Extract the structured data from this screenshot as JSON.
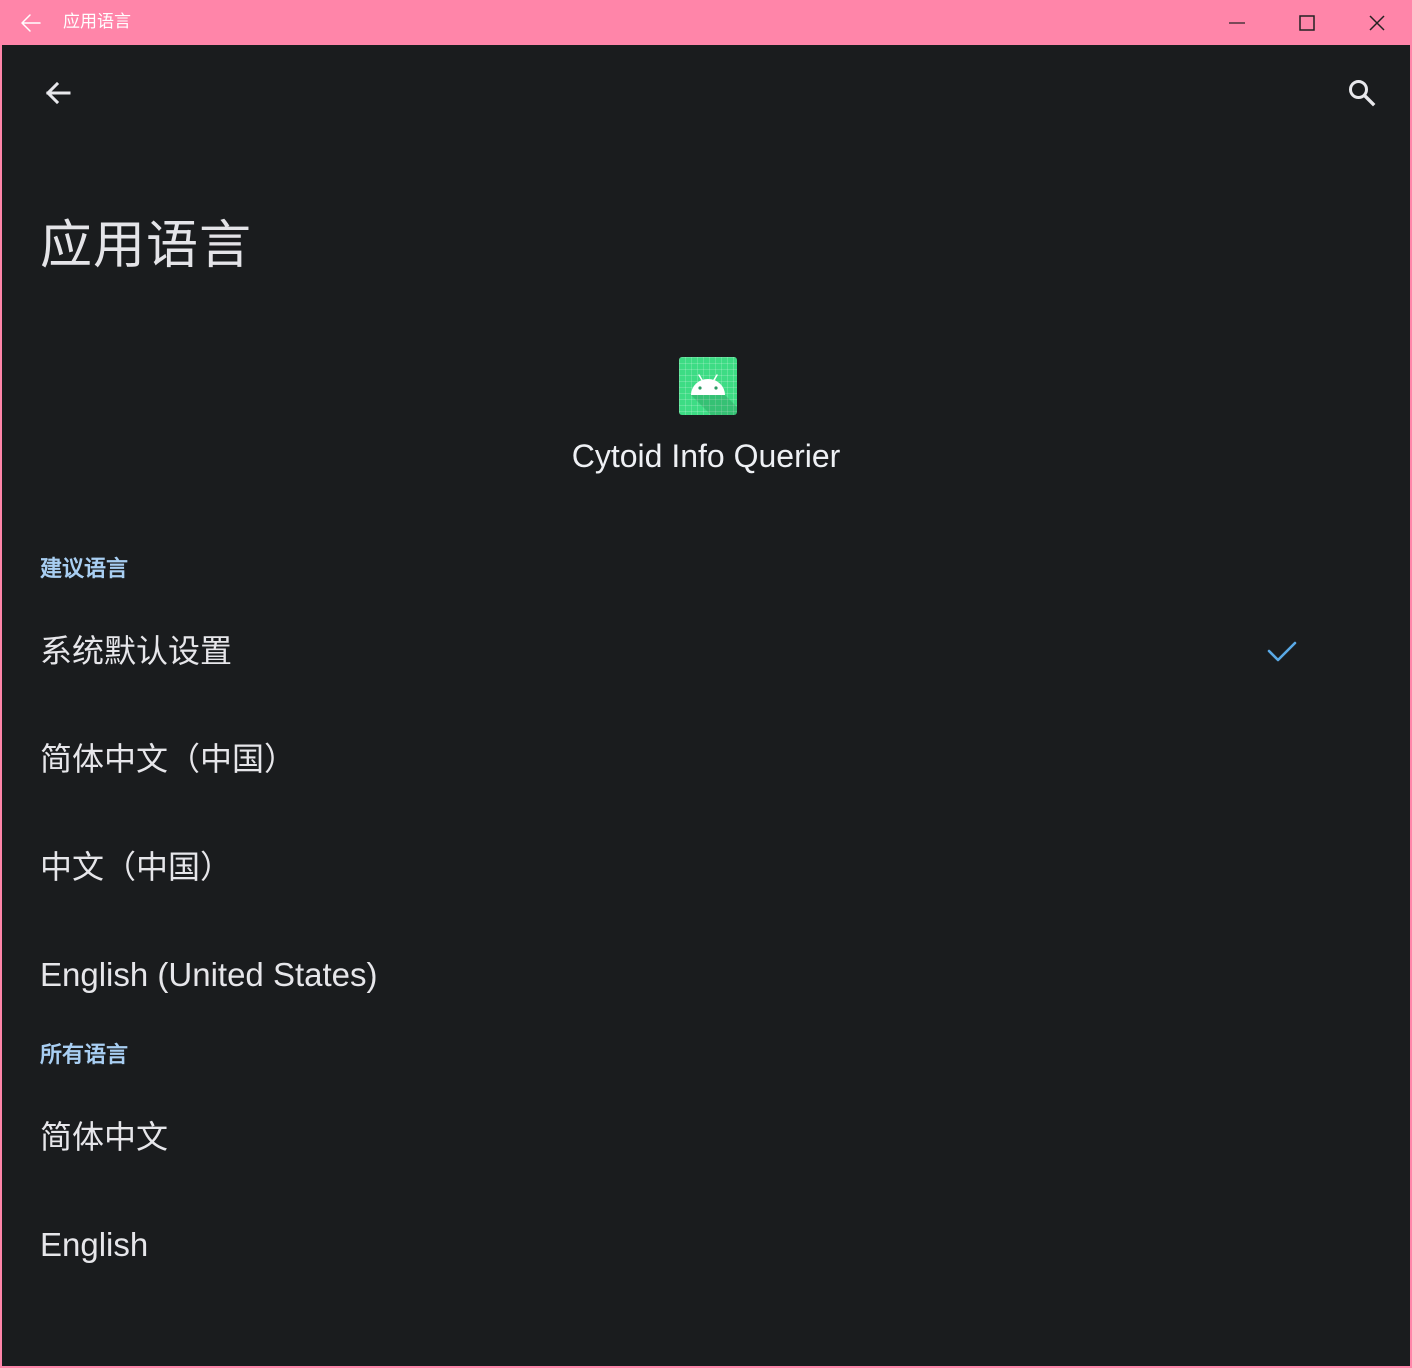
{
  "window": {
    "title": "应用语言",
    "controls": {
      "minimize_icon": "minimize-icon",
      "maximize_icon": "maximize-icon",
      "close_icon": "close-icon"
    }
  },
  "appbar": {
    "back_icon": "arrow-back-icon",
    "search_icon": "search-icon"
  },
  "page": {
    "title": "应用语言"
  },
  "app": {
    "icon": "android-icon",
    "name": "Cytoid Info Querier"
  },
  "sections": {
    "suggested": {
      "header": "建议语言",
      "items": [
        {
          "label": "系统默认设置",
          "selected": true
        },
        {
          "label": "简体中文（中国）",
          "selected": false
        },
        {
          "label": "中文（中国）",
          "selected": false
        },
        {
          "label": "English (United States)",
          "selected": false
        }
      ]
    },
    "all": {
      "header": "所有语言",
      "items": [
        {
          "label": "简体中文",
          "selected": false
        },
        {
          "label": "English",
          "selected": false
        }
      ]
    }
  },
  "colors": {
    "titlebar": "#ff85a9",
    "background": "#1a1c1e",
    "section_header": "#a8cef2",
    "check": "#5aa9e6",
    "app_icon": "#3ddc84"
  }
}
